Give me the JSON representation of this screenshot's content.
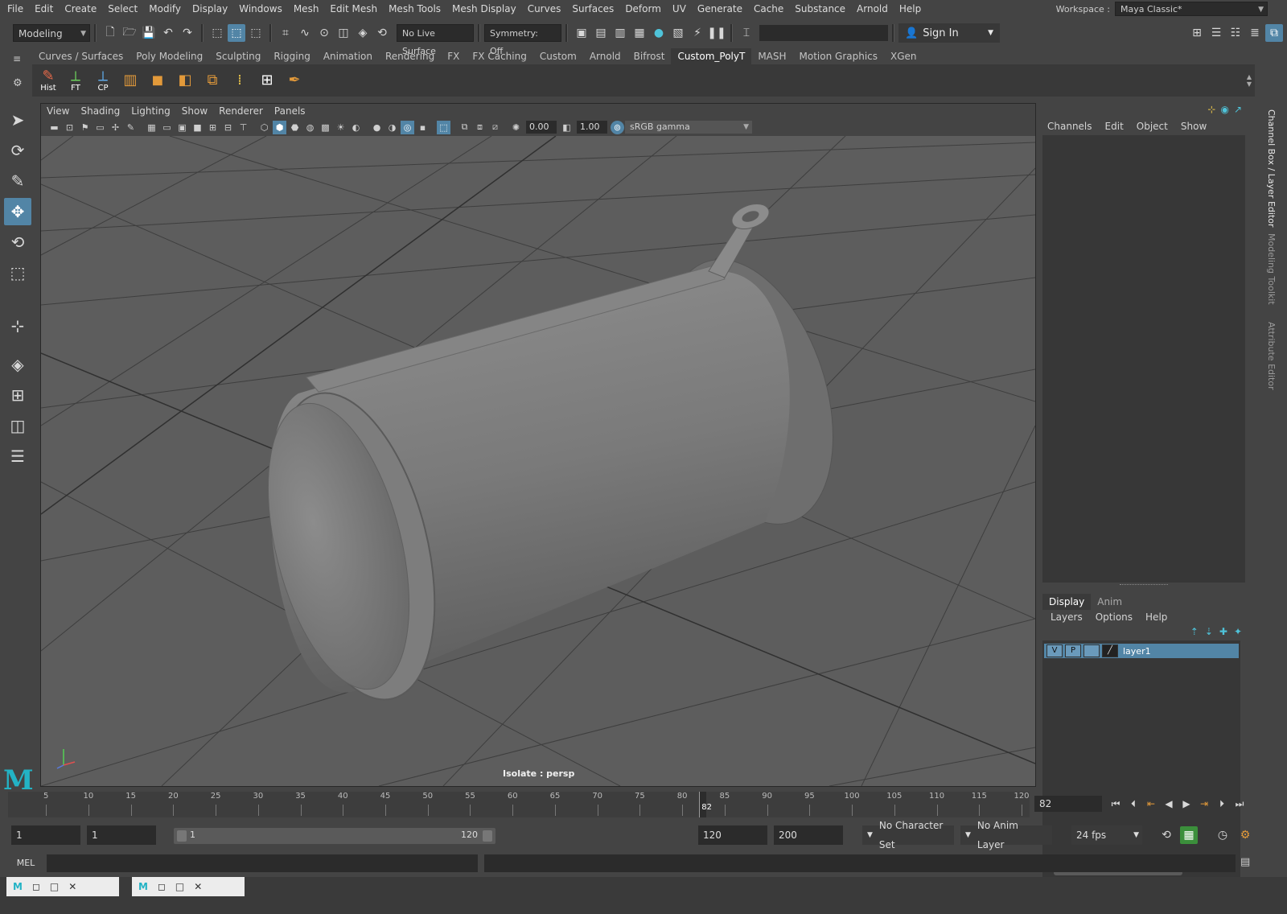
{
  "menubar": {
    "items": [
      "File",
      "Edit",
      "Create",
      "Select",
      "Modify",
      "Display",
      "Windows",
      "Mesh",
      "Edit Mesh",
      "Mesh Tools",
      "Mesh Display",
      "Curves",
      "Surfaces",
      "Deform",
      "UV",
      "Generate",
      "Cache",
      "Substance",
      "Arnold",
      "Help"
    ],
    "workspace_label": "Workspace :",
    "workspace_value": "Maya Classic*"
  },
  "statusline": {
    "mode": "Modeling",
    "live_surface": "No Live Surface",
    "symmetry": "Symmetry: Off",
    "sign_in": "Sign In"
  },
  "shelf": {
    "tabs": [
      "Curves / Surfaces",
      "Poly Modeling",
      "Sculpting",
      "Rigging",
      "Animation",
      "Rendering",
      "FX",
      "FX Caching",
      "Custom",
      "Arnold",
      "Bifrost",
      "Custom_PolyT",
      "MASH",
      "Motion Graphics",
      "XGen"
    ],
    "active_tab": "Custom_PolyT",
    "buttons": [
      {
        "label": "Hist",
        "icon": "history-icon"
      },
      {
        "label": "FT",
        "icon": "freeze-transform-icon"
      },
      {
        "label": "CP",
        "icon": "center-pivot-icon"
      }
    ]
  },
  "viewport": {
    "menu": [
      "View",
      "Shading",
      "Lighting",
      "Show",
      "Renderer",
      "Panels"
    ],
    "exposure": "0.00",
    "gamma": "1.00",
    "color_space": "sRGB gamma",
    "isolate_label": "Isolate : persp"
  },
  "channel_box": {
    "menu": [
      "Channels",
      "Edit",
      "Object",
      "Show"
    ]
  },
  "layer_editor": {
    "tabs": [
      "Display",
      "Anim"
    ],
    "active_tab": "Display",
    "menu": [
      "Layers",
      "Options",
      "Help"
    ],
    "layers": [
      {
        "v": "V",
        "p": "P",
        "name": "layer1"
      }
    ]
  },
  "side_tabs": [
    "Channel Box / Layer Editor",
    "Modeling Toolkit",
    "Attribute Editor"
  ],
  "timeline": {
    "ticks": [
      "5",
      "10",
      "15",
      "20",
      "25",
      "30",
      "35",
      "40",
      "45",
      "50",
      "55",
      "60",
      "65",
      "70",
      "75",
      "80",
      "85",
      "90",
      "95",
      "100",
      "105",
      "110",
      "115",
      "120"
    ],
    "current_frame_marker": "82",
    "current_frame_field": "82"
  },
  "range": {
    "start": "1",
    "playback_start": "1",
    "slider_start": "1",
    "slider_end": "120",
    "playback_end": "120",
    "end": "200",
    "character_set": "No Character Set",
    "anim_layer": "No Anim Layer",
    "fps": "24 fps"
  },
  "command": {
    "label": "MEL"
  },
  "colors": {
    "accent": "#5285a6",
    "maya_logo": "#23b3c5"
  }
}
